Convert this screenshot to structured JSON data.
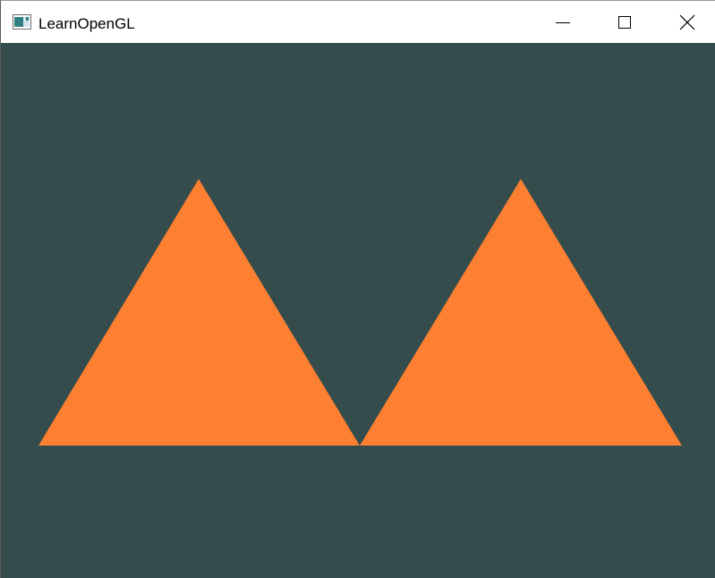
{
  "window": {
    "title": "LearnOpenGL",
    "icon": "opengl-app-icon",
    "controls": {
      "minimize_icon": "minimize-icon",
      "maximize_icon": "maximize-icon",
      "close_icon": "close-icon"
    }
  },
  "viewport": {
    "clear_color": "#344c4c",
    "shape_color": "#fd7f31",
    "shapes": [
      "triangle",
      "triangle"
    ]
  }
}
